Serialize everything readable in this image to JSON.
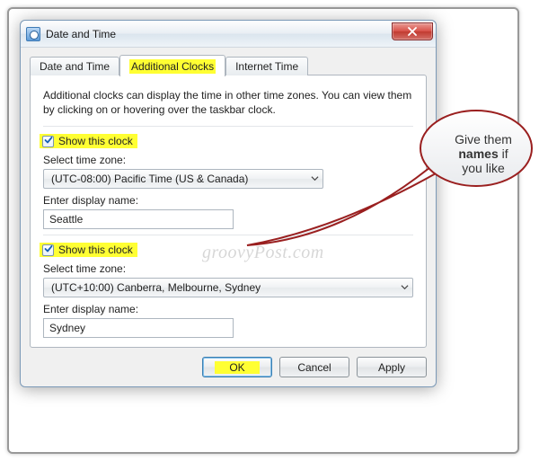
{
  "window": {
    "title": "Date and Time"
  },
  "tabs": {
    "t0": "Date and Time",
    "t1": "Additional Clocks",
    "t2": "Internet Time"
  },
  "description": "Additional clocks can display the time in other time zones. You can view them by clicking on or hovering over the taskbar clock.",
  "clock1": {
    "checkbox_label": "Show this clock",
    "tz_label": "Select time zone:",
    "tz_value": "(UTC-08:00) Pacific Time (US & Canada)",
    "name_label": "Enter display name:",
    "name_value": "Seattle"
  },
  "clock2": {
    "checkbox_label": "Show this clock",
    "tz_label": "Select time zone:",
    "tz_value": "(UTC+10:00) Canberra, Melbourne, Sydney",
    "name_label": "Enter display name:",
    "name_value": "Sydney"
  },
  "buttons": {
    "ok": "OK",
    "cancel": "Cancel",
    "apply": "Apply"
  },
  "callout": {
    "line1": "Give them",
    "line2_bold": "names",
    "line2_rest": " if",
    "line3": "you like"
  },
  "watermark": "groovyPost.com"
}
